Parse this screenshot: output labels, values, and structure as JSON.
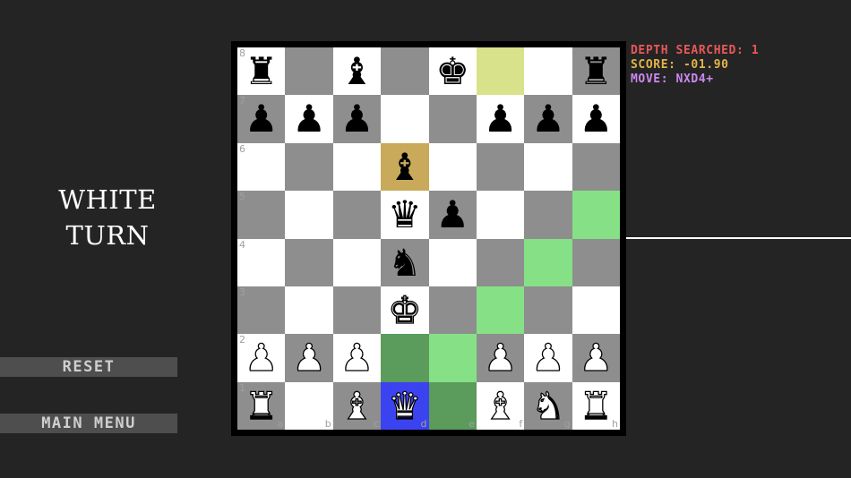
{
  "turn": {
    "line1": "WHITE",
    "line2": "TURN"
  },
  "buttons": {
    "reset": "RESET",
    "main_menu": "MAIN MENU"
  },
  "engine_info": {
    "depth": "DEPTH SEARCHED: 1",
    "score": "SCORE: -01.90",
    "move": "MOVE: NXD4+"
  },
  "colors": {
    "depth": "#e8585a",
    "score": "#e3b44a",
    "move": "#cc88ee"
  },
  "board": {
    "rank_labels": [
      "8",
      "7",
      "6",
      "5",
      "4",
      "3",
      "2",
      "1"
    ],
    "file_labels": [
      "a",
      "b",
      "c",
      "d",
      "e",
      "f",
      "g",
      "h"
    ],
    "rows": [
      [
        {
          "p": "bR"
        },
        {
          "p": ""
        },
        {
          "p": "bB"
        },
        {
          "p": ""
        },
        {
          "p": "bK"
        },
        {
          "p": "",
          "h": "last"
        },
        {
          "p": ""
        },
        {
          "p": "bR"
        }
      ],
      [
        {
          "p": "bP"
        },
        {
          "p": "bP"
        },
        {
          "p": "bP"
        },
        {
          "p": ""
        },
        {
          "p": ""
        },
        {
          "p": "bP"
        },
        {
          "p": "bP"
        },
        {
          "p": "bP"
        }
      ],
      [
        {
          "p": ""
        },
        {
          "p": ""
        },
        {
          "p": ""
        },
        {
          "p": "bB",
          "h": "sel"
        },
        {
          "p": ""
        },
        {
          "p": ""
        },
        {
          "p": ""
        },
        {
          "p": ""
        }
      ],
      [
        {
          "p": ""
        },
        {
          "p": ""
        },
        {
          "p": ""
        },
        {
          "p": "bQ"
        },
        {
          "p": "bP"
        },
        {
          "p": ""
        },
        {
          "p": ""
        },
        {
          "p": "",
          "h": "move"
        }
      ],
      [
        {
          "p": ""
        },
        {
          "p": ""
        },
        {
          "p": ""
        },
        {
          "p": "bN"
        },
        {
          "p": ""
        },
        {
          "p": ""
        },
        {
          "p": "",
          "h": "move"
        },
        {
          "p": ""
        }
      ],
      [
        {
          "p": ""
        },
        {
          "p": ""
        },
        {
          "p": ""
        },
        {
          "p": "wK"
        },
        {
          "p": ""
        },
        {
          "p": "",
          "h": "move"
        },
        {
          "p": ""
        },
        {
          "p": ""
        }
      ],
      [
        {
          "p": "wP"
        },
        {
          "p": "wP"
        },
        {
          "p": "wP"
        },
        {
          "p": "",
          "h": "capt"
        },
        {
          "p": "",
          "h": "move"
        },
        {
          "p": "wP"
        },
        {
          "p": "wP"
        },
        {
          "p": "wP"
        }
      ],
      [
        {
          "p": "wR"
        },
        {
          "p": ""
        },
        {
          "p": "wB"
        },
        {
          "p": "wQ",
          "h": "check"
        },
        {
          "p": "",
          "h": "capt"
        },
        {
          "p": "wB"
        },
        {
          "p": "wN"
        },
        {
          "p": "wR"
        }
      ]
    ]
  }
}
